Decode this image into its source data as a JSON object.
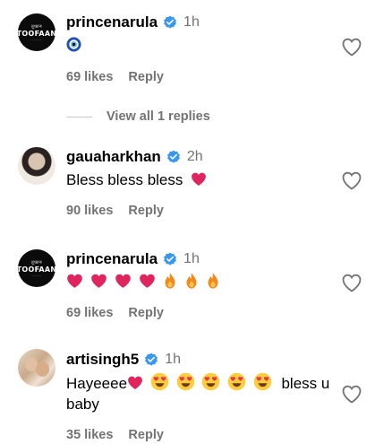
{
  "comments": [
    {
      "username": "princenarula",
      "time": "1h",
      "text": "",
      "emojis": [
        "nazar-amulet"
      ],
      "likes": "69 likes",
      "reply": "Reply",
      "avatar_text": [
        "तूफ़ान",
        "TOOFAAN",
        "............"
      ]
    },
    {
      "username": "gauaharkhan",
      "time": "2h",
      "text": "Bless bless bless",
      "likes": "90 likes",
      "reply": "Reply"
    },
    {
      "username": "princenarula",
      "time": "1h",
      "emojis": [
        "red-heart",
        "red-heart",
        "red-heart",
        "red-heart",
        "fire",
        "fire",
        "fire"
      ],
      "likes": "69 likes",
      "reply": "Reply",
      "avatar_text": [
        "तूफ़ान",
        "TOOFAAN",
        "............"
      ]
    },
    {
      "username": "artisingh5",
      "time": "1h",
      "text_start": "Hayeeee",
      "text_end": "bless u",
      "text_line2": "baby",
      "likes": "35 likes",
      "reply": "Reply"
    }
  ],
  "view_replies": "View all 1 replies",
  "colors": {
    "verified": "#3897f0",
    "meta": "#737373",
    "heart": "#e0245e"
  }
}
